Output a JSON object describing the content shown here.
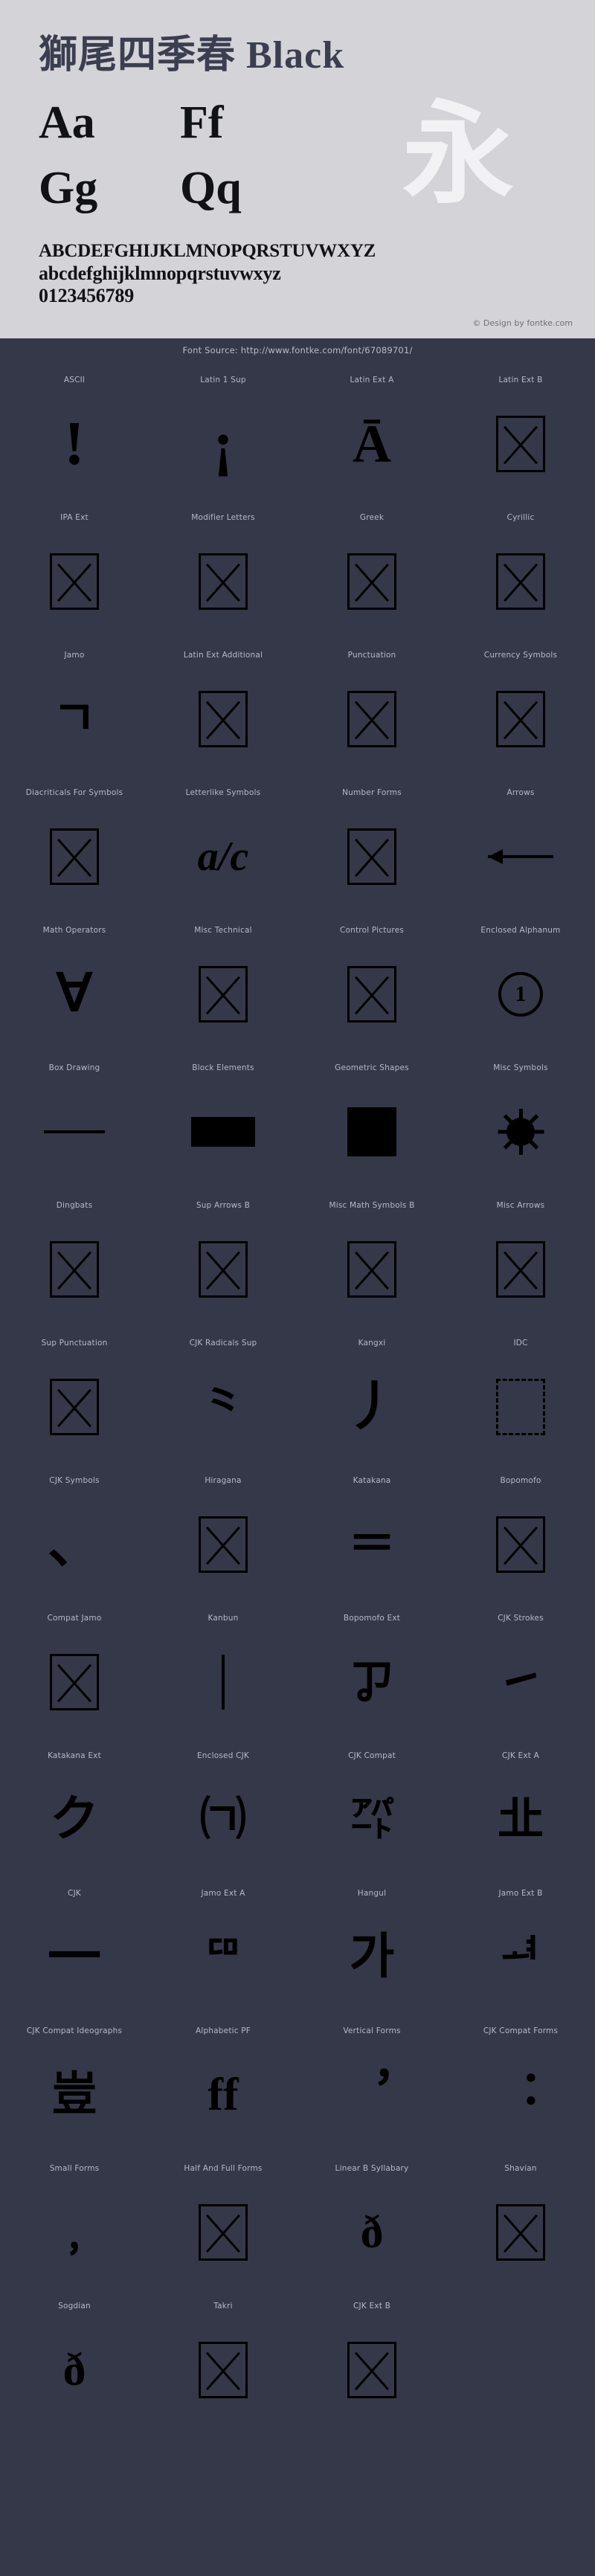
{
  "header": {
    "title_cjk": "獅尾四季春",
    "title_style": "Black",
    "title_full": "獅尾四季春 Black",
    "samples": [
      {
        "text": "Aa",
        "name": "sample-glyph-aa"
      },
      {
        "text": "Ff",
        "name": "sample-glyph-ff"
      },
      {
        "text": "Gg",
        "name": "sample-glyph-gg"
      },
      {
        "text": "Qq",
        "name": "sample-glyph-qq"
      }
    ],
    "sample_cjk": "永",
    "alphabet_upper": "ABCDEFGHIJKLMNOPQRSTUVWXYZ",
    "alphabet_lower": "abcdefghijklmnopqrstuvwxyz",
    "digits": "0123456789",
    "credit": "© Design by fontke.com",
    "source": "Font Source: http://www.fontke.com/font/67089701/",
    "bg_color": "#d4d3d7",
    "title_color": "#3b3e50",
    "dark_color": "#353848"
  },
  "blocks": [
    {
      "label": "ASCII",
      "glyph": "!",
      "kind": "text",
      "size": 84
    },
    {
      "label": "Latin 1 Sup",
      "glyph": "¡",
      "kind": "text",
      "size": 84
    },
    {
      "label": "Latin Ext A",
      "glyph": "Ā",
      "kind": "text",
      "size": 72
    },
    {
      "label": "Latin Ext B",
      "glyph": "",
      "kind": "tofu"
    },
    {
      "label": "IPA Ext",
      "glyph": "",
      "kind": "tofu"
    },
    {
      "label": "Modifier Letters",
      "glyph": "",
      "kind": "tofu"
    },
    {
      "label": "Greek",
      "glyph": "",
      "kind": "tofu"
    },
    {
      "label": "Cyrillic",
      "glyph": "",
      "kind": "tofu"
    },
    {
      "label": "Jamo",
      "glyph": "ㄱ",
      "kind": "text",
      "size": 64
    },
    {
      "label": "Latin Ext Additional",
      "glyph": "",
      "kind": "tofu"
    },
    {
      "label": "Punctuation",
      "glyph": "",
      "kind": "tofu"
    },
    {
      "label": "Currency Symbols",
      "glyph": "",
      "kind": "tofu"
    },
    {
      "label": "Diacriticals For Symbols",
      "glyph": "",
      "kind": "tofu"
    },
    {
      "label": "Letterlike Symbols",
      "glyph": "a/c",
      "kind": "text-italic",
      "size": 56
    },
    {
      "label": "Number Forms",
      "glyph": "",
      "kind": "tofu"
    },
    {
      "label": "Arrows",
      "glyph": "←",
      "kind": "arrow-left"
    },
    {
      "label": "Math Operators",
      "glyph": "∀",
      "kind": "text",
      "size": 70
    },
    {
      "label": "Misc Technical",
      "glyph": "",
      "kind": "tofu"
    },
    {
      "label": "Control Pictures",
      "glyph": "",
      "kind": "tofu"
    },
    {
      "label": "Enclosed Alphanum",
      "glyph": "1",
      "kind": "circle-num"
    },
    {
      "label": "Box Drawing",
      "glyph": "─",
      "kind": "hline"
    },
    {
      "label": "Block Elements",
      "glyph": "█",
      "kind": "block-elem"
    },
    {
      "label": "Geometric Shapes",
      "glyph": "■",
      "kind": "solid-box"
    },
    {
      "label": "Misc Symbols",
      "glyph": "☀",
      "kind": "sun"
    },
    {
      "label": "Dingbats",
      "glyph": "",
      "kind": "tofu"
    },
    {
      "label": "Sup Arrows B",
      "glyph": "",
      "kind": "tofu"
    },
    {
      "label": "Misc Math Symbols B",
      "glyph": "",
      "kind": "tofu"
    },
    {
      "label": "Misc Arrows",
      "glyph": "",
      "kind": "tofu"
    },
    {
      "label": "Sup Punctuation",
      "glyph": "",
      "kind": "tofu"
    },
    {
      "label": "CJK Radicals Sup",
      "glyph": "⺀",
      "kind": "text",
      "size": 64
    },
    {
      "label": "Kangxi",
      "glyph": "⼃",
      "kind": "text",
      "size": 72
    },
    {
      "label": "IDC",
      "glyph": "",
      "kind": "tofu-dashed"
    },
    {
      "label": "CJK Symbols",
      "glyph": "、",
      "kind": "text",
      "size": 72
    },
    {
      "label": "Hiragana",
      "glyph": "",
      "kind": "tofu"
    },
    {
      "label": "Katakana",
      "glyph": "＝",
      "kind": "text",
      "size": 64
    },
    {
      "label": "Bopomofo",
      "glyph": "",
      "kind": "tofu"
    },
    {
      "label": "Compat Jamo",
      "glyph": "",
      "kind": "tofu"
    },
    {
      "label": "Kanbun",
      "glyph": "㆐",
      "kind": "vline"
    },
    {
      "label": "Bopomofo Ext",
      "glyph": "ㆡ",
      "kind": "text",
      "size": 62
    },
    {
      "label": "CJK Strokes",
      "glyph": "㇀",
      "kind": "text",
      "size": 62
    },
    {
      "label": "Katakana Ext",
      "glyph": "ク",
      "kind": "text",
      "size": 66
    },
    {
      "label": "Enclosed CJK",
      "glyph": "㈀",
      "kind": "text",
      "size": 62
    },
    {
      "label": "CJK Compat",
      "glyph": "㌀",
      "kind": "text",
      "size": 58
    },
    {
      "label": "CJK Ext A",
      "glyph": "㐀",
      "kind": "text",
      "size": 62
    },
    {
      "label": "CJK",
      "glyph": "一",
      "kind": "text",
      "size": 72
    },
    {
      "label": "Jamo Ext A",
      "glyph": "ꥠ",
      "kind": "text",
      "size": 58
    },
    {
      "label": "Hangul",
      "glyph": "가",
      "kind": "text",
      "size": 66
    },
    {
      "label": "Jamo Ext B",
      "glyph": "ힰ",
      "kind": "text",
      "size": 58
    },
    {
      "label": "CJK Compat Ideographs",
      "glyph": "豈",
      "kind": "text",
      "size": 62
    },
    {
      "label": "Alphabetic PF",
      "glyph": "ff",
      "kind": "text",
      "size": 62
    },
    {
      "label": "Vertical Forms",
      "glyph": "︐",
      "kind": "text",
      "size": 62
    },
    {
      "label": "CJK Compat Forms",
      "glyph": "︓",
      "kind": "text",
      "size": 62
    },
    {
      "label": "Small Forms",
      "glyph": "﹐",
      "kind": "text",
      "size": 62
    },
    {
      "label": "Half And Full Forms",
      "glyph": "",
      "kind": "tofu"
    },
    {
      "label": "Linear B Syllabary",
      "glyph": "ð",
      "kind": "text",
      "size": 62
    },
    {
      "label": "Shavian",
      "glyph": "",
      "kind": "tofu"
    },
    {
      "label": "Sogdian",
      "glyph": "ð",
      "kind": "text",
      "size": 62
    },
    {
      "label": "Takri",
      "glyph": "",
      "kind": "tofu"
    },
    {
      "label": "CJK Ext B",
      "glyph": "",
      "kind": "tofu"
    },
    {
      "label": "",
      "glyph": "",
      "kind": "empty"
    }
  ]
}
